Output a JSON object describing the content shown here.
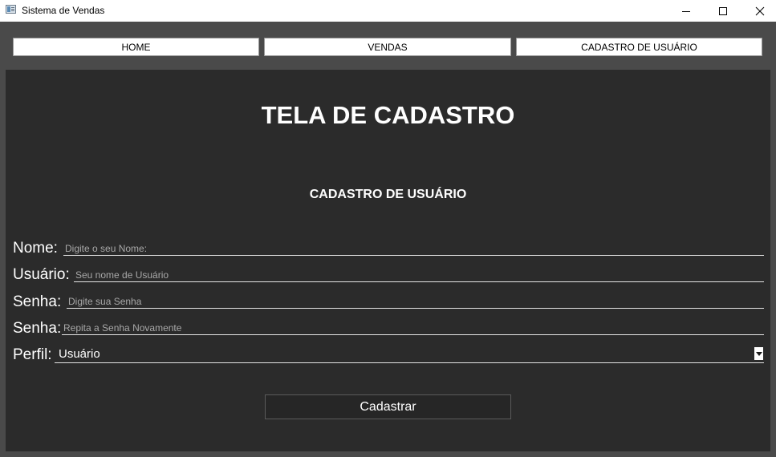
{
  "window": {
    "title": "Sistema de Vendas"
  },
  "nav": {
    "tabs": [
      {
        "label": "HOME"
      },
      {
        "label": "VENDAS"
      },
      {
        "label": "CADASTRO DE USUÁRIO"
      }
    ]
  },
  "main": {
    "title": "TELA DE CADASTRO",
    "subtitle": "CADASTRO DE USUÁRIO",
    "fields": [
      {
        "label": "Nome:",
        "placeholder": "Digite o seu Nome:",
        "value": ""
      },
      {
        "label": "Usuário:",
        "placeholder": "Seu nome de Usuário",
        "value": ""
      },
      {
        "label": "Senha:",
        "placeholder": "Digite sua Senha",
        "value": ""
      },
      {
        "label": "Senha:",
        "placeholder": "Repita a Senha Novamente",
        "value": ""
      }
    ],
    "profile": {
      "label": "Perfil:",
      "selected": "Usuário"
    },
    "submit_label": "Cadastrar"
  },
  "colors": {
    "background": "#4a4a4a",
    "panel": "#2b2b2b",
    "text": "#ffffff",
    "placeholder": "#a8a8a8"
  },
  "icons": [
    "app-icon",
    "minimize-icon",
    "maximize-icon",
    "close-icon",
    "chevron-down-icon"
  ]
}
